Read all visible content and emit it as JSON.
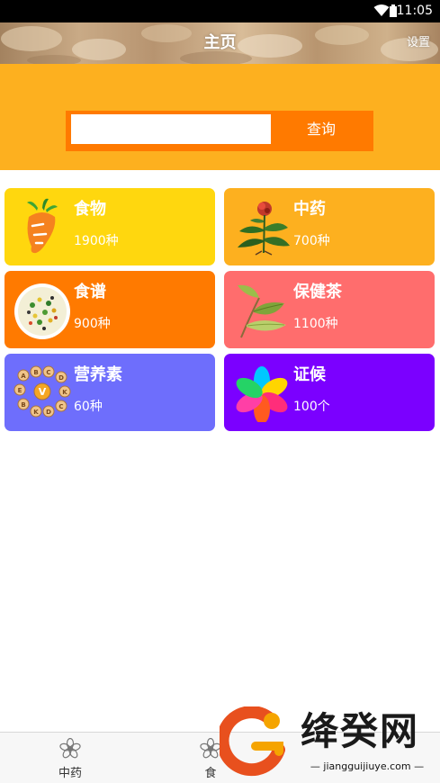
{
  "status_bar": {
    "time": "11:05"
  },
  "header": {
    "title": "主页",
    "settings_label": "设置"
  },
  "search": {
    "value": "",
    "button_label": "查询"
  },
  "cards": [
    {
      "title": "食物",
      "count": "1900种",
      "color": "#ffd70e",
      "icon": "carrot-icon"
    },
    {
      "title": "中药",
      "count": "700种",
      "color": "#fdb01f",
      "icon": "herb-plant-icon"
    },
    {
      "title": "食谱",
      "count": "900种",
      "color": "#ff7a00",
      "icon": "salad-plate-icon"
    },
    {
      "title": "保健茶",
      "count": "1100种",
      "color": "#ff6d6d",
      "icon": "tea-leaf-icon"
    },
    {
      "title": "营养素",
      "count": "60种",
      "color": "#6e6efc",
      "icon": "vitamin-letters-icon"
    },
    {
      "title": "证候",
      "count": "100个",
      "color": "#7b00ff",
      "icon": "colorful-petals-icon"
    }
  ],
  "bottom_nav": [
    {
      "label": "中药",
      "icon": "flower-icon"
    },
    {
      "label": "食",
      "icon": "flower-icon"
    }
  ],
  "watermark": {
    "text": "绛癸网",
    "url": "jiangguijiuye.com"
  }
}
